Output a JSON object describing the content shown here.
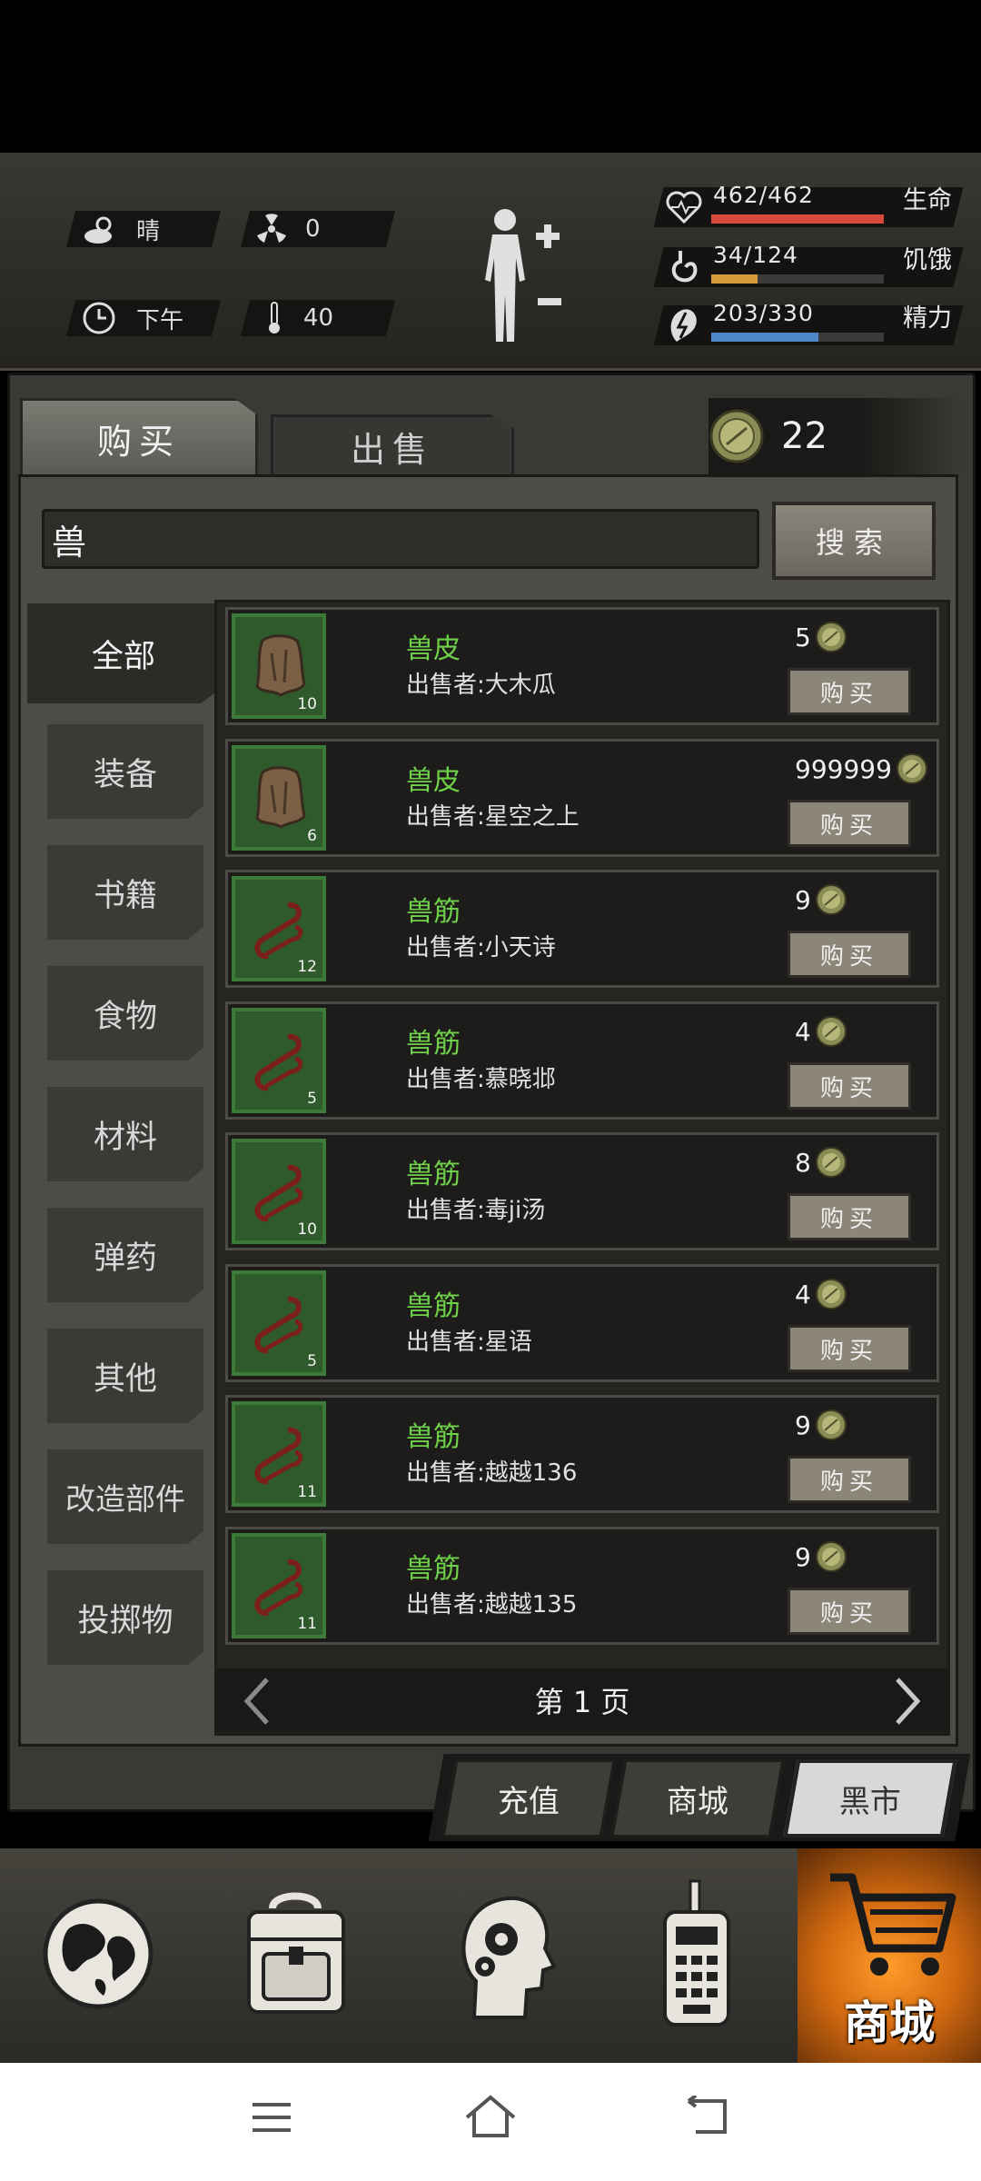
{
  "status": {
    "weather": "晴",
    "radiation": "0",
    "time_of_day": "下午",
    "temperature": "40",
    "health": {
      "text": "462/462",
      "label": "生命",
      "fraction": 1.0,
      "color": "#d9493c"
    },
    "hunger": {
      "text": "34/124",
      "label": "饥饿",
      "fraction": 0.27,
      "color": "#d79a3a"
    },
    "energy": {
      "text": "203/330",
      "label": "精力",
      "fraction": 0.62,
      "color": "#4f86c6"
    }
  },
  "tabs": {
    "buy": "购买",
    "sell": "出售"
  },
  "coins": "22",
  "search": {
    "value": "兽",
    "button": "搜索"
  },
  "categories": [
    "全部",
    "装备",
    "书籍",
    "食物",
    "材料",
    "弹药",
    "其他",
    "改造部件",
    "投掷物"
  ],
  "listings": [
    {
      "name": "兽皮",
      "seller": "出售者:大木瓜",
      "price": "5",
      "qty": "10",
      "icon": "hide-icon"
    },
    {
      "name": "兽皮",
      "seller": "出售者:星空之上",
      "price": "999999",
      "qty": "6",
      "icon": "hide-icon"
    },
    {
      "name": "兽筋",
      "seller": "出售者:小天诗",
      "price": "9",
      "qty": "12",
      "icon": "tendon-icon"
    },
    {
      "name": "兽筋",
      "seller": "出售者:慕晓邶",
      "price": "4",
      "qty": "5",
      "icon": "tendon-icon"
    },
    {
      "name": "兽筋",
      "seller": "出售者:毒ji汤",
      "price": "8",
      "qty": "10",
      "icon": "tendon-icon"
    },
    {
      "name": "兽筋",
      "seller": "出售者:星语",
      "price": "4",
      "qty": "5",
      "icon": "tendon-icon"
    },
    {
      "name": "兽筋",
      "seller": "出售者:越越136",
      "price": "9",
      "qty": "11",
      "icon": "tendon-icon"
    },
    {
      "name": "兽筋",
      "seller": "出售者:越越135",
      "price": "9",
      "qty": "11",
      "icon": "tendon-icon"
    }
  ],
  "buy_label": "购买",
  "pager": "第 1 页",
  "store_tabs": {
    "recharge": "充值",
    "mall": "商城",
    "black_market": "黑市"
  },
  "nav": {
    "shop_label": "商城"
  }
}
